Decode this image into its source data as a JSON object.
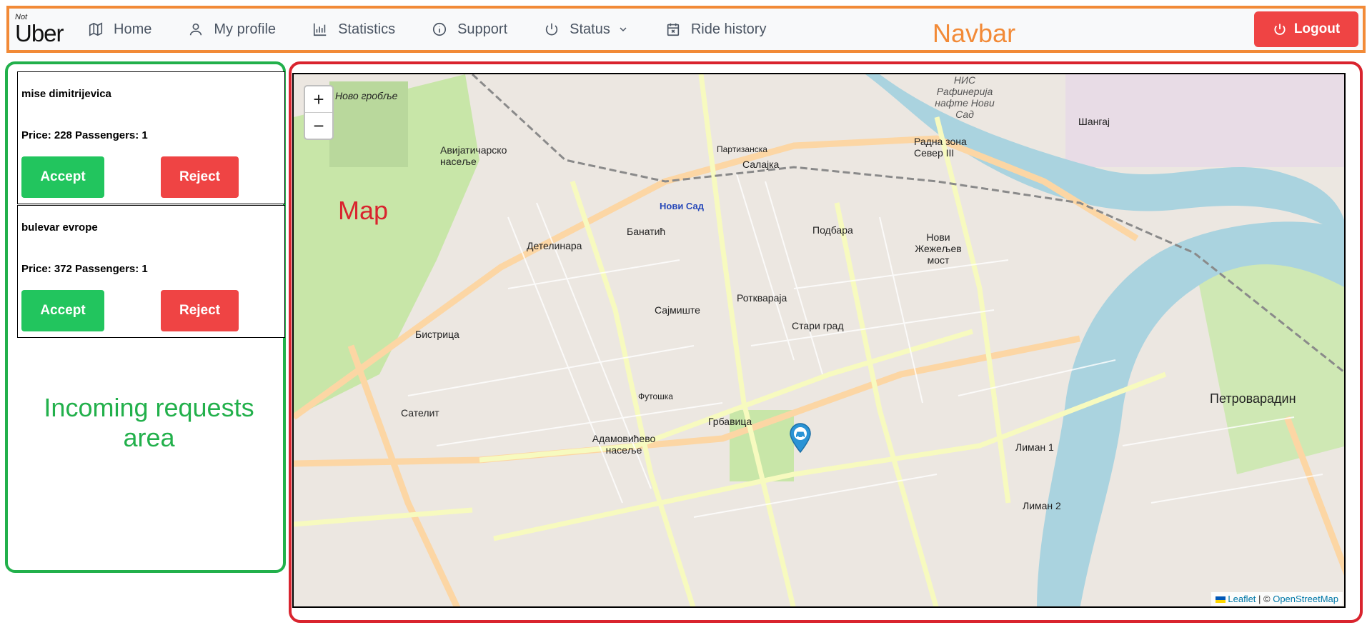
{
  "app": {
    "logo_small": "Not",
    "logo_main": "Uber"
  },
  "navbar": {
    "items": [
      {
        "label": "Home",
        "icon": "map-icon"
      },
      {
        "label": "My profile",
        "icon": "user-icon"
      },
      {
        "label": "Statistics",
        "icon": "bar-chart-icon"
      },
      {
        "label": "Support",
        "icon": "info-icon"
      },
      {
        "label": "Status",
        "icon": "power-icon"
      },
      {
        "label": "Ride history",
        "icon": "calendar-icon"
      }
    ],
    "logout_label": "Logout",
    "annotation": "Navbar"
  },
  "requests": {
    "annotation_line1": "Incoming requests",
    "annotation_line2": "area",
    "items": [
      {
        "address": "mise dimitrijevica",
        "info": "Price: 228 Passengers: 1",
        "accept": "Accept",
        "reject": "Reject"
      },
      {
        "address": "bulevar evrope",
        "info": "Price: 372 Passengers: 1",
        "accept": "Accept",
        "reject": "Reject"
      }
    ]
  },
  "map": {
    "annotation": "Map",
    "zoom_in": "+",
    "zoom_out": "−",
    "attribution": {
      "leaflet": "Leaflet",
      "separator": " | © ",
      "osm": "OpenStreetMap"
    },
    "places": [
      "Ново гробље",
      "Авијатичарско насеље",
      "Детелинара",
      "Банатић",
      "Нови Сад",
      "Салајка",
      "Радна зона Север III",
      "Подбара",
      "Нови Жежељев мост",
      "Шангај",
      "Ротквараја",
      "Сајмиште",
      "Стари град",
      "Бистрица",
      "Сателит",
      "Грбавица",
      "Адамовићево насеље",
      "Лиман 1",
      "Лиман 2",
      "Петроварадин",
      "Футошка",
      "Партизанска",
      "НИС Рафинерија нафте Нови Сад"
    ],
    "colors": {
      "water": "#aad3df",
      "park": "#c8e6a8",
      "road_major": "#f7fabf",
      "road_primary": "#fcd6a4"
    }
  }
}
